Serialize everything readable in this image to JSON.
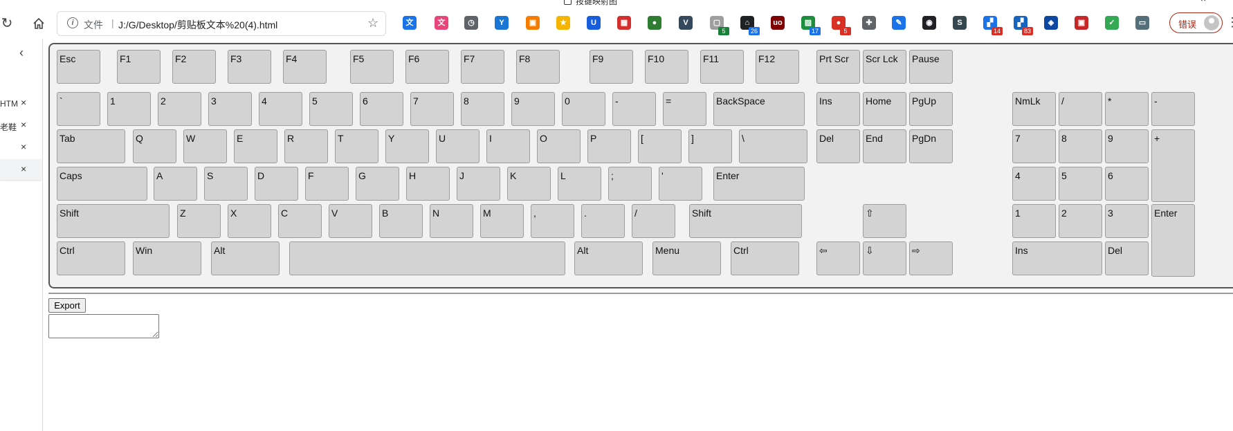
{
  "window": {
    "title_fragment": "按键映射图",
    "close_glyph": "×"
  },
  "toolbar": {
    "reload_icon": "reload-icon",
    "home_icon": "home-icon",
    "address": {
      "scheme_label": "文件",
      "separator": "|",
      "url": "J:/G/Desktop/剪贴板文本%20(4).html"
    },
    "extensions": [
      {
        "name": "translate",
        "color": "#1a73e8",
        "glyph": "文"
      },
      {
        "name": "ext-pink",
        "color": "#e8457a",
        "glyph": "文"
      },
      {
        "name": "clock",
        "color": "#5f6368",
        "glyph": "◷"
      },
      {
        "name": "ext-y",
        "color": "#1976d2",
        "glyph": "Y"
      },
      {
        "name": "ext-orange",
        "color": "#f57c00",
        "glyph": "▣"
      },
      {
        "name": "star",
        "color": "#f4b400",
        "glyph": "★"
      },
      {
        "name": "bitwarden",
        "color": "#175ddc",
        "glyph": "U"
      },
      {
        "name": "ext-grid",
        "color": "#d32f2f",
        "glyph": "▦"
      },
      {
        "name": "ext-green-dot",
        "color": "#2e7d32",
        "glyph": "●"
      },
      {
        "name": "vue",
        "color": "#35495e",
        "glyph": "V"
      },
      {
        "name": "ext-dashed",
        "color": "#9e9e9e",
        "glyph": "▢",
        "badge": "5",
        "badge_color": "#188038"
      },
      {
        "name": "ext-lock",
        "color": "#202124",
        "glyph": "⌂",
        "badge": "26",
        "badge_color": "#1a73e8"
      },
      {
        "name": "ublock",
        "color": "#800000",
        "glyph": "uo"
      },
      {
        "name": "ext-image",
        "color": "#1e8e3e",
        "glyph": "▨",
        "badge": "17",
        "badge_color": "#1a73e8"
      },
      {
        "name": "ext-red",
        "color": "#d93025",
        "glyph": "●",
        "badge": "5",
        "badge_color": "#d93025"
      },
      {
        "name": "puzzle",
        "color": "#5f6368",
        "glyph": "✚"
      },
      {
        "name": "pen",
        "color": "#1a73e8",
        "glyph": "✎"
      },
      {
        "name": "ext-dark",
        "color": "#202124",
        "glyph": "◉"
      },
      {
        "name": "ext-s",
        "color": "#37474f",
        "glyph": "S"
      },
      {
        "name": "ext-blocks",
        "color": "#1a73e8",
        "glyph": "▞",
        "badge": "14",
        "badge_color": "#d93025"
      },
      {
        "name": "ext-blocks2",
        "color": "#1565c0",
        "glyph": "▞",
        "badge": "83",
        "badge_color": "#d93025"
      },
      {
        "name": "ext-shield",
        "color": "#0d47a1",
        "glyph": "◈"
      },
      {
        "name": "ext-redsq",
        "color": "#c62828",
        "glyph": "▣"
      },
      {
        "name": "ext-check",
        "color": "#34a853",
        "glyph": "✓"
      },
      {
        "name": "ext-screen",
        "color": "#546e7a",
        "glyph": "▭"
      }
    ],
    "profile_label": "错误"
  },
  "sidepanel": {
    "back_icon": "chevron-left-icon",
    "items": [
      {
        "text": "HTM",
        "close": "×"
      },
      {
        "text": "老鞋",
        "close": "×"
      },
      {
        "text": "",
        "close": "×"
      },
      {
        "text": "",
        "close": "×"
      }
    ]
  },
  "keyboard": {
    "keys": [
      {
        "label": "Esc"
      },
      {
        "label": "F1"
      },
      {
        "label": "F2"
      },
      {
        "label": "F3"
      },
      {
        "label": "F4"
      },
      {
        "label": "F5"
      },
      {
        "label": "F6"
      },
      {
        "label": "F7"
      },
      {
        "label": "F8"
      },
      {
        "label": "F9"
      },
      {
        "label": "F10"
      },
      {
        "label": "F11"
      },
      {
        "label": "F12"
      },
      {
        "label": "Prt Scr"
      },
      {
        "label": "Scr Lck"
      },
      {
        "label": "Pause"
      },
      {
        "label": "`"
      },
      {
        "label": "1"
      },
      {
        "label": "2"
      },
      {
        "label": "3"
      },
      {
        "label": "4"
      },
      {
        "label": "5"
      },
      {
        "label": "6"
      },
      {
        "label": "7"
      },
      {
        "label": "8"
      },
      {
        "label": "9"
      },
      {
        "label": "0"
      },
      {
        "label": "-"
      },
      {
        "label": "="
      },
      {
        "label": "BackSpace"
      },
      {
        "label": "Ins"
      },
      {
        "label": "Home"
      },
      {
        "label": "PgUp"
      },
      {
        "label": "NmLk"
      },
      {
        "label": "/"
      },
      {
        "label": "*"
      },
      {
        "label": "-"
      },
      {
        "label": "Tab"
      },
      {
        "label": "Q"
      },
      {
        "label": "W"
      },
      {
        "label": "E"
      },
      {
        "label": "R"
      },
      {
        "label": "T"
      },
      {
        "label": "Y"
      },
      {
        "label": "U"
      },
      {
        "label": "I"
      },
      {
        "label": "O"
      },
      {
        "label": "P"
      },
      {
        "label": "["
      },
      {
        "label": "]"
      },
      {
        "label": "\\"
      },
      {
        "label": "Del"
      },
      {
        "label": "End"
      },
      {
        "label": "PgDn"
      },
      {
        "label": "7"
      },
      {
        "label": "8"
      },
      {
        "label": "9"
      },
      {
        "label": "+"
      },
      {
        "label": "Caps"
      },
      {
        "label": "A"
      },
      {
        "label": "S"
      },
      {
        "label": "D"
      },
      {
        "label": "F"
      },
      {
        "label": "G"
      },
      {
        "label": "H"
      },
      {
        "label": "J"
      },
      {
        "label": "K"
      },
      {
        "label": "L"
      },
      {
        "label": ";"
      },
      {
        "label": "'"
      },
      {
        "label": "Enter"
      },
      {
        "label": "4"
      },
      {
        "label": "5"
      },
      {
        "label": "6"
      },
      {
        "label": "Shift"
      },
      {
        "label": "Z"
      },
      {
        "label": "X"
      },
      {
        "label": "C"
      },
      {
        "label": "V"
      },
      {
        "label": "B"
      },
      {
        "label": "N"
      },
      {
        "label": "M"
      },
      {
        "label": ","
      },
      {
        "label": "."
      },
      {
        "label": "/"
      },
      {
        "label": "Shift"
      },
      {
        "label": "⇧"
      },
      {
        "label": "1"
      },
      {
        "label": "2"
      },
      {
        "label": "3"
      },
      {
        "label": "Enter"
      },
      {
        "label": "Ctrl"
      },
      {
        "label": "Win"
      },
      {
        "label": "Alt"
      },
      {
        "label": ""
      },
      {
        "label": "Alt"
      },
      {
        "label": "Menu"
      },
      {
        "label": "Ctrl"
      },
      {
        "label": "⇦"
      },
      {
        "label": "⇩"
      },
      {
        "label": "⇨"
      },
      {
        "label": "Ins"
      },
      {
        "label": "Del"
      }
    ]
  },
  "export": {
    "button_label": "Export",
    "textarea_value": ""
  }
}
